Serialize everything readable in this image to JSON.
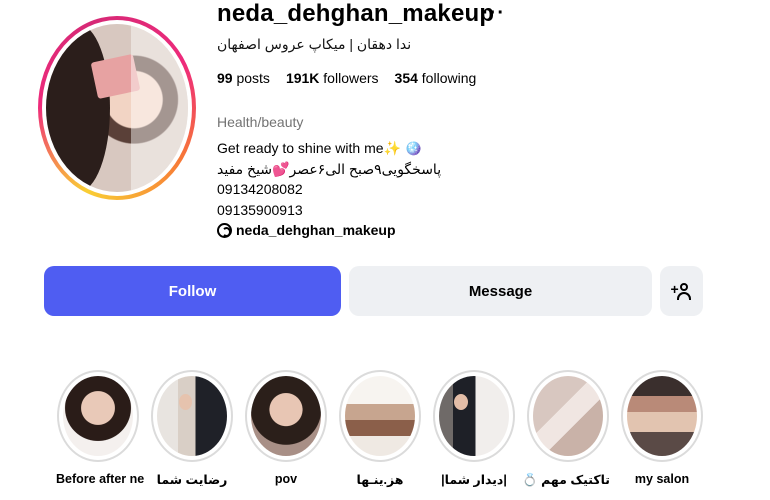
{
  "profile": {
    "username": "neda_dehghan_makeup",
    "full_name": "ندا دهقان | میکاپ عروس اصفهان",
    "posts_count": "99",
    "posts_label": "posts",
    "followers_count": "191K",
    "followers_label": "followers",
    "following_count": "354",
    "following_label": "following",
    "category": "Health/beauty",
    "bio_lines": [
      "Get ready to shine with me✨ 🪩",
      "پاسخگویی۹صبح الی۶عصر💕شیخ مفید",
      "09134208082",
      "09135900913"
    ],
    "threads_handle": "neda_dehghan_makeup"
  },
  "actions": {
    "follow_label": "Follow",
    "message_label": "Message",
    "more_label": "···"
  },
  "highlights": [
    {
      "label": "Before after ne"
    },
    {
      "label": "رضایت شما"
    },
    {
      "label": "pov"
    },
    {
      "label": "هز.ینـها"
    },
    {
      "label": "|دیدار شما|"
    },
    {
      "label": "تاکتیک مهم 💍"
    },
    {
      "label": "my salon"
    }
  ],
  "colors": {
    "follow_button": "#4f5df2",
    "secondary_button": "#eef0f3",
    "category_text": "#737373"
  }
}
